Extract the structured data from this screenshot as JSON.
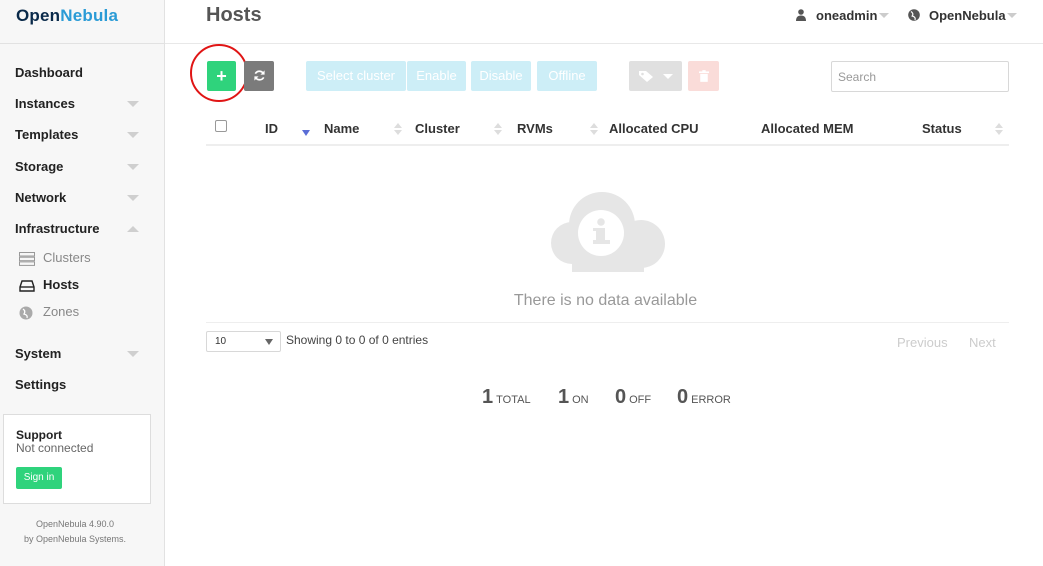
{
  "brand": {
    "name_part1": "Open",
    "name_part2": "Nebula"
  },
  "sidebar": {
    "items": [
      {
        "label": "Dashboard"
      },
      {
        "label": "Instances"
      },
      {
        "label": "Templates"
      },
      {
        "label": "Storage"
      },
      {
        "label": "Network"
      },
      {
        "label": "Infrastructure"
      },
      {
        "label": "System"
      },
      {
        "label": "Settings"
      }
    ],
    "infrastructure_children": [
      {
        "label": "Clusters",
        "icon": "server-stack-icon"
      },
      {
        "label": "Hosts",
        "icon": "hdd-icon",
        "active": true
      },
      {
        "label": "Zones",
        "icon": "globe-icon"
      }
    ],
    "support": {
      "title": "Support",
      "status": "Not connected",
      "signin_label": "Sign in"
    },
    "footer": {
      "version": "OpenNebula 4.90.0",
      "byline": "by OpenNebula Systems."
    }
  },
  "header": {
    "title": "Hosts",
    "user": {
      "label": "oneadmin",
      "icon": "user-icon"
    },
    "zone": {
      "label": "OpenNebula",
      "icon": "globe-icon"
    }
  },
  "toolbar": {
    "create_label": "+",
    "refresh_icon": "refresh-icon",
    "select_cluster_label": "Select cluster",
    "enable_label": "Enable",
    "disable_label": "Disable",
    "offline_label": "Offline",
    "labels_icon": "tags-icon",
    "delete_icon": "trash-icon",
    "search_placeholder": "Search",
    "search_value": ""
  },
  "table": {
    "columns": [
      "ID",
      "Name",
      "Cluster",
      "RVMs",
      "Allocated CPU",
      "Allocated MEM",
      "Status"
    ],
    "empty_text": "There is no data available",
    "page_length": "10",
    "entries_info": "Showing 0 to 0 of 0 entries",
    "prev_label": "Previous",
    "next_label": "Next"
  },
  "stats": [
    {
      "value": "1",
      "label": "TOTAL"
    },
    {
      "value": "1",
      "label": "ON"
    },
    {
      "value": "0",
      "label": "OFF"
    },
    {
      "value": "0",
      "label": "ERROR"
    }
  ],
  "colors": {
    "create": "#2fd37c",
    "refresh": "#7b7b7b",
    "disabled_action": "#cdeef7",
    "delete_disabled": "#fadcd9",
    "highlight_ring": "#e01515",
    "brand_blue": "#2a9bd6"
  }
}
